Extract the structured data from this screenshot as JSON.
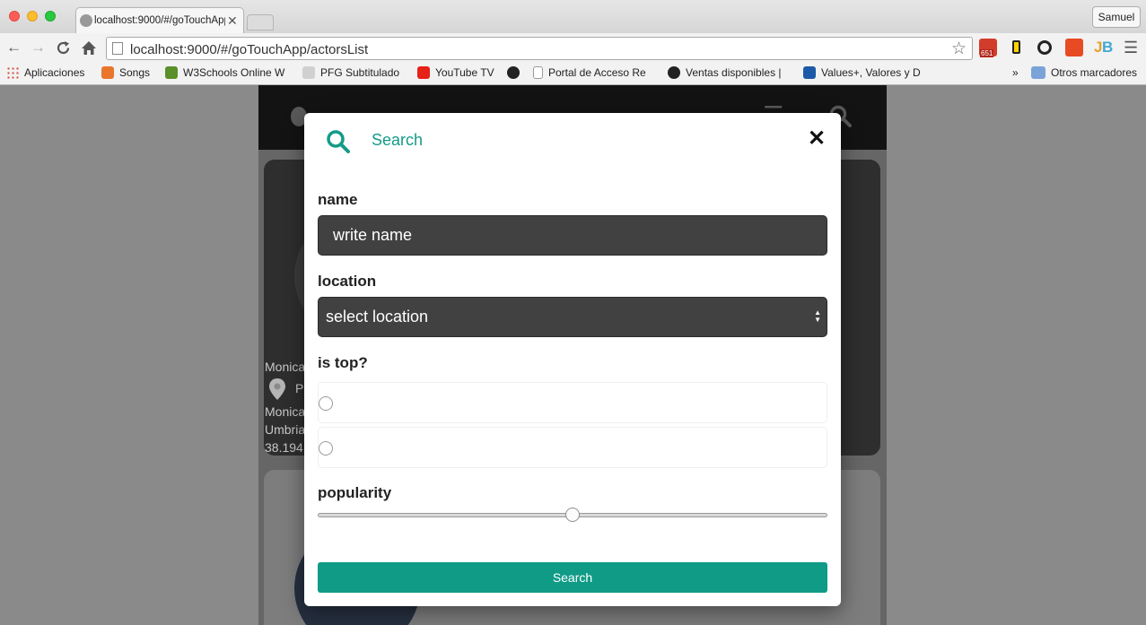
{
  "browser": {
    "tab_title": "localhost:9000/#/goTouchApp/actorsList",
    "tab_close": "✕",
    "user_button": "Samuel",
    "url": "localhost:9000/#/goTouchApp/actorsList",
    "bookmarks": [
      {
        "label": "Aplicaciones",
        "color": "#d04a3a"
      },
      {
        "label": "Songs",
        "color": "#e8762c"
      },
      {
        "label": "W3Schools Online W",
        "color": "#5a8f29"
      },
      {
        "label": "PFG Subtitulado",
        "color": "#7a7a7a"
      },
      {
        "label": "YouTube TV",
        "color": "#e62117"
      },
      {
        "label": "",
        "color": "#222222"
      },
      {
        "label": "Portal de Acceso Re",
        "color": "#bdbdbd"
      },
      {
        "label": "Ventas disponibles |",
        "color": "#222222"
      },
      {
        "label": "Values+, Valores y D",
        "color": "#1b5aa8"
      }
    ],
    "bookmarks_overflow": "»",
    "other_bookmarks": "Otros marcadores",
    "gmail_badge": "651"
  },
  "background": {
    "snippets": [
      "Monica",
      "P",
      "Monica",
      "Umbria",
      "38.194"
    ]
  },
  "modal": {
    "title": "Search",
    "close_glyph": "✕",
    "name_label": "name",
    "name_placeholder": "write name",
    "location_label": "location",
    "location_value": "select location",
    "is_top_label": "is top?",
    "popularity_label": "popularity",
    "popularity_value": 0.5,
    "submit_label": "Search"
  },
  "colors": {
    "accent": "#109b87",
    "field_bg": "#414141",
    "overlay": "#8a8a8a"
  },
  "icons": [
    "search-icon",
    "close-icon",
    "hamburger-menu-icon",
    "map-pin-icon",
    "home-icon",
    "reload-icon",
    "star-icon",
    "folder-icon"
  ]
}
